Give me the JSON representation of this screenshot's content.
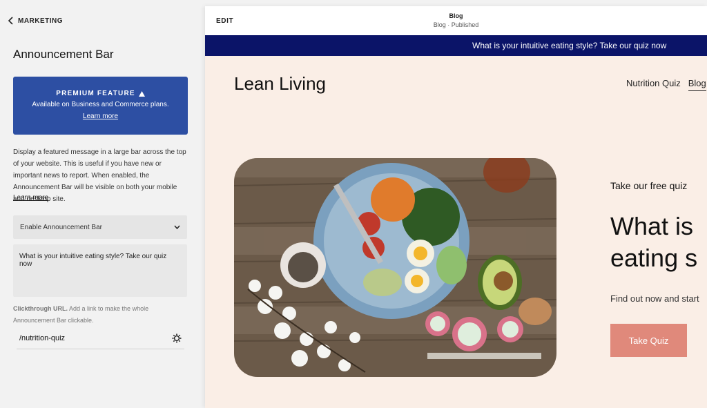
{
  "panel": {
    "back_label": "MARKETING",
    "title": "Announcement Bar",
    "premium": {
      "title": "PREMIUM FEATURE",
      "subtitle": "Available on Business and Commerce plans.",
      "link": "Learn more"
    },
    "description": "Display a featured message in a large bar across the top of your website. This is useful if you have new or important news to report. When enabled, the Announcement Bar will be visible on both your mobile and desktop site.",
    "description_link": "Learn more",
    "enable_select": "Enable Announcement Bar",
    "message_text": "What is your intuitive eating style? Take our quiz now",
    "clickthrough_label": "Clickthrough URL.",
    "clickthrough_help": "Add a link to make the whole Announcement Bar clickable.",
    "url_value": "/nutrition-quiz"
  },
  "preview": {
    "edit_label": "EDIT",
    "page_title": "Blog",
    "page_status": "Blog · Published",
    "announcement": "What is your intuitive eating style? Take our quiz now",
    "site_title": "Lean Living",
    "nav": [
      {
        "label": "Nutrition Quiz"
      },
      {
        "label": "Blog"
      }
    ],
    "kicker": "Take our free quiz",
    "headline_line1": "What is",
    "headline_line2": "eating s",
    "subtext": "Find out now and start",
    "cta": "Take Quiz"
  },
  "colors": {
    "premium_bg": "#2d4fa3",
    "announcement_bg": "#0b1468",
    "site_bg": "#faeee6",
    "cta_bg": "#e0897b"
  },
  "icons": [
    "chevron-left-icon",
    "crown-icon",
    "chevron-down-icon",
    "gear-icon"
  ]
}
